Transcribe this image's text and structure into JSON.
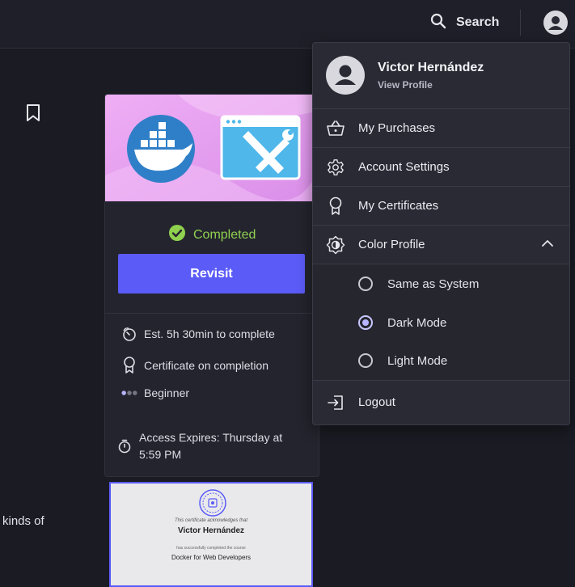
{
  "topbar": {
    "search_label": "Search"
  },
  "background": {
    "partial_text": "kinds of"
  },
  "course_card": {
    "status": "Completed",
    "revisit_label": "Revisit",
    "info": [
      {
        "icon": "clock-icon",
        "text": "Est. 5h 30min to complete"
      },
      {
        "icon": "award-icon",
        "text": "Certificate on completion"
      },
      {
        "icon": "level-dots-icon",
        "text": "Beginner"
      }
    ],
    "expires_line1": "Access Expires: Thursday at",
    "expires_line2": "5:59 PM",
    "colors": {
      "accent": "#5b5bf7",
      "success": "#8fd14f",
      "banner": "#e8a8f0"
    }
  },
  "certificate": {
    "line1": "This certificate acknowledges that",
    "name": "Victor Hernández",
    "line2": "has successfully completed the course",
    "course": "Docker for Web Developers"
  },
  "dropdown": {
    "user_name": "Victor Hernández",
    "view_profile": "View Profile",
    "items": [
      {
        "label": "My Purchases",
        "icon": "basket-icon"
      },
      {
        "label": "Account Settings",
        "icon": "gear-icon"
      },
      {
        "label": "My Certificates",
        "icon": "award-icon"
      },
      {
        "label": "Color Profile",
        "icon": "brightness-icon"
      }
    ],
    "color_options": [
      {
        "label": "Same as System",
        "selected": false
      },
      {
        "label": "Dark Mode",
        "selected": true
      },
      {
        "label": "Light Mode",
        "selected": false
      }
    ],
    "logout_label": "Logout"
  }
}
